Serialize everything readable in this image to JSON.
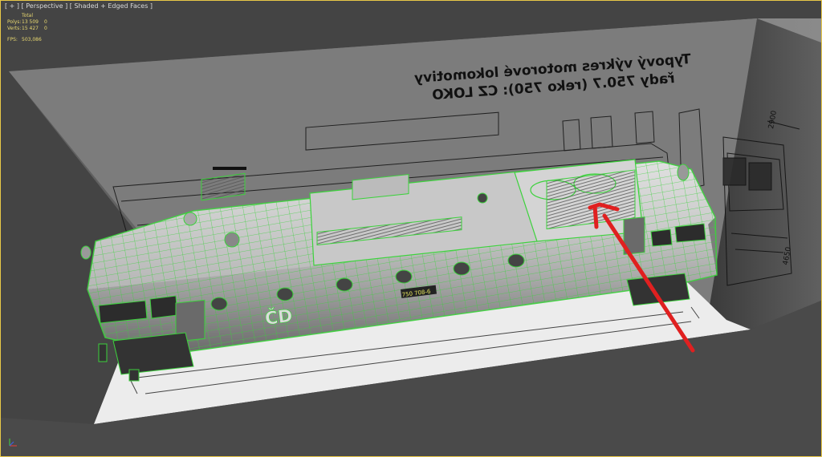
{
  "viewport": {
    "label": "[ + ] [ Perspective ] [ Shaded + Edged Faces ]"
  },
  "stats": {
    "header": "Total",
    "rows": [
      {
        "key": "Polys:",
        "value": "13 509",
        "sel": "0"
      },
      {
        "key": "Verts:",
        "value": "15 427",
        "sel": "0"
      }
    ],
    "fps_label": "FPS:",
    "fps_value": "503,086"
  },
  "blueprint": {
    "title_line1": "Typový výkres motorové lokomotivy",
    "title_line2": "řady 750.7 (reko 750): CZ LOKO",
    "dim_top": "2900",
    "dim_side": "4650"
  },
  "locomotive": {
    "number_plate": "750 708-6",
    "logo": "ČD"
  },
  "colors": {
    "wireframe": "#3cd23c",
    "arrow": "#e02020",
    "background": "#444444"
  },
  "icons": {
    "axis_gizmo": "axis-gizmo-icon",
    "arrow": "red-arrow"
  }
}
